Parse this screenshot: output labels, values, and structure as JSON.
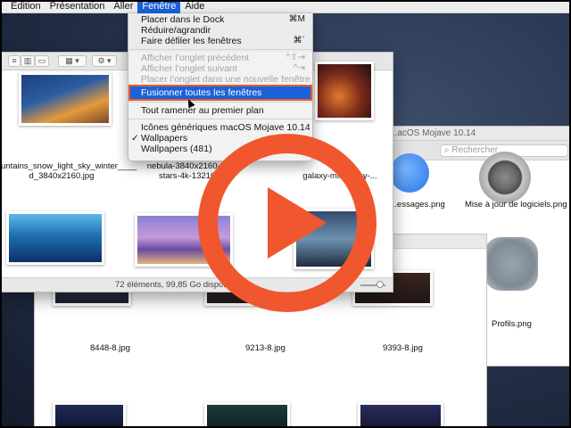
{
  "menubar": {
    "items": [
      {
        "label": "Édition"
      },
      {
        "label": "Présentation"
      },
      {
        "label": "Aller"
      },
      {
        "label": "Fenêtre",
        "active": true
      },
      {
        "label": "Aide"
      }
    ]
  },
  "window_menu": {
    "items": [
      {
        "label": "Placer dans le Dock",
        "shortcut": "⌘M"
      },
      {
        "label": "Réduire/agrandir",
        "shortcut": ""
      },
      {
        "label": "Faire défiler les fenêtres",
        "shortcut": "⌘`"
      },
      {
        "label": "Afficher l’onglet précédent",
        "shortcut": "^⇧⇥",
        "disabled": true
      },
      {
        "label": "Afficher l’onglet suivant",
        "shortcut": "^⇥",
        "disabled": true
      },
      {
        "label": "Placer l’onglet dans une nouvelle fenêtre",
        "disabled": true
      },
      {
        "label": "Fusionner toutes les fenêtres",
        "highlighted": true
      },
      {
        "label": "Tout ramener au premier plan"
      },
      {
        "label": "Icônes génériques macOS Mojave 10.14"
      },
      {
        "label": "Wallpapers",
        "checked": true
      },
      {
        "label": "Wallpapers (481)"
      }
    ]
  },
  "main_window": {
    "files": [
      {
        "name": "untains_snow_light_sky_winter____\nd_3840x2160.jpg"
      },
      {
        "name": "nebula-3840x2160-pink-\nstars-4k-13210.j..."
      },
      {
        "name": "...lar-\ngalaxy-milky-way-..."
      }
    ],
    "status": "72 éléments, 99,85 Go disponible(s)"
  },
  "back_window": {
    "title": "...acOS Mojave 10.14",
    "search_placeholder": "Rechercher",
    "files": [
      {
        "name": "...essages.png"
      },
      {
        "name": "Mise à jour de logiciels.png"
      },
      {
        "name": "Profils.png"
      }
    ]
  },
  "lower_window": {
    "files": [
      {
        "name": "8448-8.jpg"
      },
      {
        "name": "9213-8.jpg"
      },
      {
        "name": "9393-8.jpg"
      }
    ]
  },
  "colors": {
    "accent": "#1a62d8",
    "play_overlay": "#f0572e"
  }
}
